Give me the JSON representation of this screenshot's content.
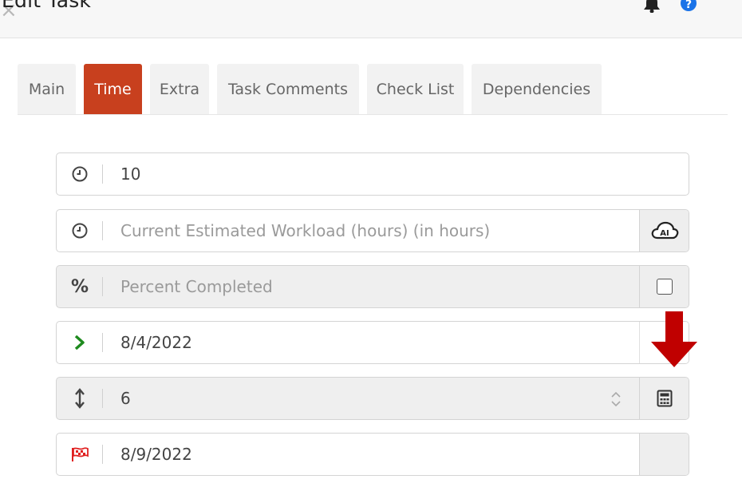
{
  "header": {
    "title": "Edit Task"
  },
  "tabs": [
    {
      "label": "Main",
      "active": false
    },
    {
      "label": "Time",
      "active": true
    },
    {
      "label": "Extra",
      "active": false
    },
    {
      "label": "Task Comments",
      "active": false
    },
    {
      "label": "Check List",
      "active": false
    },
    {
      "label": "Dependencies",
      "active": false
    }
  ],
  "fields": {
    "planned_workload": {
      "value": "10",
      "icon": "clock-icon"
    },
    "current_estimated_workload": {
      "value": "",
      "placeholder": "Current Estimated Workload (hours) (in hours)",
      "icon": "clock-icon",
      "addon": "ai-cloud-icon"
    },
    "percent_completed": {
      "value": "",
      "placeholder": "Percent Completed",
      "icon": "percent-icon",
      "checked": false
    },
    "start_date": {
      "value": "8/4/2022",
      "icon": "chevron-right-icon"
    },
    "duration": {
      "value": "6",
      "icon": "vertical-arrows-icon",
      "addon": "calculator-icon"
    },
    "end_date": {
      "value": "8/9/2022",
      "icon": "flag-icon"
    }
  },
  "colors": {
    "accent": "#c8401e",
    "start_icon": "#1e8a1e",
    "end_icon": "#e02020",
    "annotation_arrow": "#c00000",
    "help_icon": "#1a73e8"
  }
}
